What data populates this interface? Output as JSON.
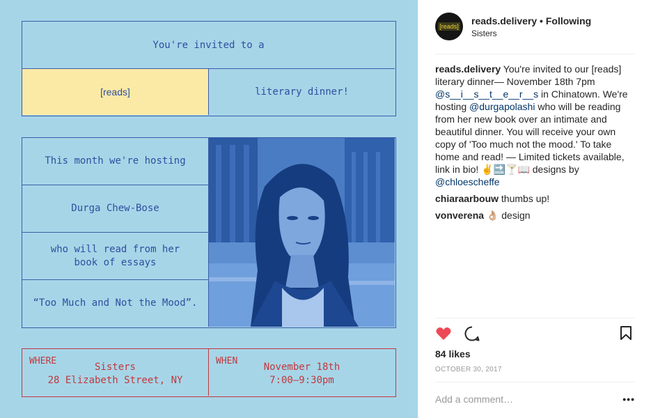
{
  "poster": {
    "invite_line": "You're invited to a",
    "reads": "[reads]",
    "literary": "literary dinner!",
    "host_line": "This month we're hosting",
    "author": "Durga Chew-Bose",
    "read_line1": "who will read from her",
    "read_line2": "book of essays",
    "book": "“Too Much and Not the Mood”.",
    "where_label": "WHERE",
    "where_line1": "Sisters",
    "where_line2": "28 Elizabeth Street, NY",
    "when_label": "WHEN",
    "when_line1": "November 18th",
    "when_line2": "7:00–9:30pm",
    "colors": {
      "background": "#a7d5e8",
      "blue": "#2f4f9e",
      "yellow": "#fbeaa6",
      "red": "#c0393d"
    }
  },
  "post": {
    "avatar_text": "[reads]",
    "username": "reads.delivery",
    "separator": " • ",
    "follow_status": "Following",
    "location": "Sisters",
    "caption": {
      "username": "reads.delivery",
      "t1": " You're invited to our [reads] literary dinner— November 18th 7pm ",
      "m1": "@s__i__s__t__e__r__s",
      "t2": " in Chinatown. We're hosting ",
      "m2": "@durgapolashi",
      "t3": " who will be reading from her new book over an intimate and beautiful dinner. You will receive your own copy of 'Too much not the mood.' To take home and read! — Limited tickets available, link in bio! ✌️🔜🍸📖 designs by ",
      "m3": "@chloescheffe"
    },
    "comments": [
      {
        "user": "chiaraarbouw",
        "text": " thumbs up!"
      },
      {
        "user": "vonverena",
        "text": " 👌🏼 design"
      }
    ],
    "likes": "84 likes",
    "date": "OCTOBER 30, 2017",
    "comment_placeholder": "Add a comment…",
    "more": "•••"
  }
}
